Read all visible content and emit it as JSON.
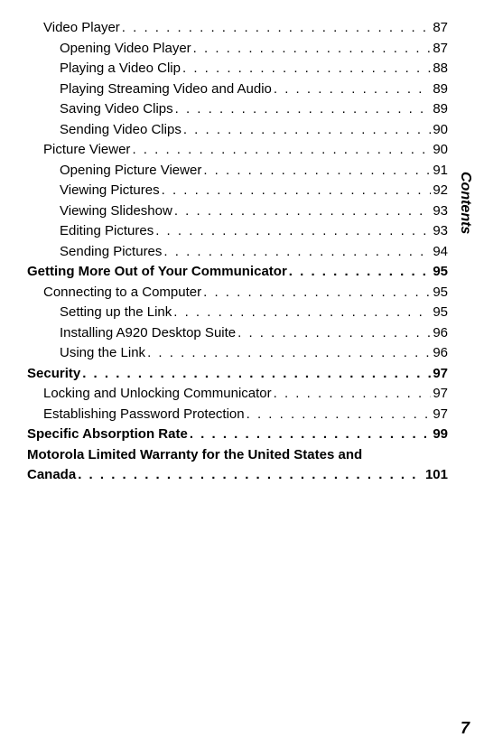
{
  "side_label": "Contents",
  "page_number": "7",
  "entries": [
    {
      "title": "Video Player",
      "page": "87",
      "level": 1
    },
    {
      "title": "Opening Video Player",
      "page": "87",
      "level": 2
    },
    {
      "title": "Playing a Video Clip",
      "page": "88",
      "level": 2
    },
    {
      "title": "Playing Streaming Video and Audio",
      "page": "89",
      "level": 2
    },
    {
      "title": "Saving Video Clips",
      "page": "89",
      "level": 2
    },
    {
      "title": "Sending Video Clips",
      "page": "90",
      "level": 2
    },
    {
      "title": "Picture Viewer",
      "page": "90",
      "level": 1
    },
    {
      "title": "Opening Picture Viewer",
      "page": "91",
      "level": 2
    },
    {
      "title": "Viewing Pictures",
      "page": "92",
      "level": 2
    },
    {
      "title": "Viewing Slideshow",
      "page": "93",
      "level": 2
    },
    {
      "title": "Editing Pictures",
      "page": "93",
      "level": 2
    },
    {
      "title": "Sending Pictures",
      "page": "94",
      "level": 2
    },
    {
      "title": "Getting More Out of Your Communicator",
      "page": "95",
      "level": 0
    },
    {
      "title": "Connecting to a Computer",
      "page": "95",
      "level": 1
    },
    {
      "title": "Setting up the Link",
      "page": "95",
      "level": 2
    },
    {
      "title": "Installing A920 Desktop Suite",
      "page": "96",
      "level": 2
    },
    {
      "title": "Using the Link",
      "page": "96",
      "level": 2
    },
    {
      "title": "Security",
      "page": "97",
      "level": 0
    },
    {
      "title": "Locking and Unlocking Communicator",
      "page": "97",
      "level": 1
    },
    {
      "title": "Establishing Password Protection",
      "page": "97",
      "level": 1
    },
    {
      "title": "Specific Absorption Rate",
      "page": "99",
      "level": 0
    }
  ],
  "wrapped_entry": {
    "line1": "Motorola Limited Warranty for the United States and",
    "line2": "Canada",
    "page": "101"
  }
}
